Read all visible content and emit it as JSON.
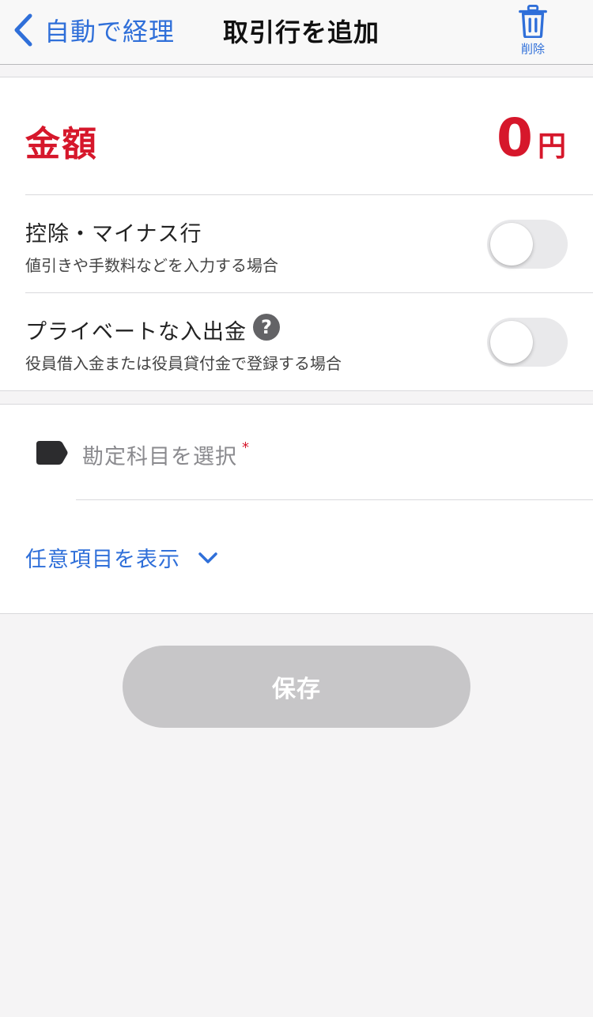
{
  "nav": {
    "back_label": "自動で経理",
    "title": "取引行を追加",
    "delete_label": "削除"
  },
  "amount": {
    "label": "金額",
    "value": "0",
    "unit": "円"
  },
  "rows": [
    {
      "title": "控除・マイナス行",
      "subtitle": "値引きや手数料などを入力する場合",
      "toggle_on": false
    },
    {
      "title": "プライベートな入出金",
      "subtitle": "役員借入金または役員貸付金で登録する場合",
      "toggle_on": false,
      "help_icon": "?"
    }
  ],
  "account": {
    "placeholder": "勘定科目を選択",
    "required_mark": "*"
  },
  "optional": {
    "label": "任意項目を表示"
  },
  "save_label": "保存",
  "colors": {
    "accent_blue": "#2f6fd9",
    "amount_red": "#d6172b",
    "disabled_button": "#c7c6c8"
  }
}
